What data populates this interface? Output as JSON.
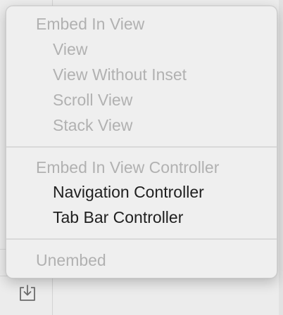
{
  "menu": {
    "embed_in_view": {
      "header": "Embed In View",
      "items": [
        "View",
        "View Without Inset",
        "Scroll View",
        "Stack View"
      ]
    },
    "embed_in_view_controller": {
      "header": "Embed In View Controller",
      "items": [
        "Navigation Controller",
        "Tab Bar Controller"
      ]
    },
    "unembed": "Unembed"
  },
  "toolbar": {
    "embed_icon": "embed-in-icon"
  },
  "colors": {
    "disabled_text": "#b1b1b1",
    "enabled_text": "#1f1f1f",
    "menu_background": "#efefef"
  }
}
